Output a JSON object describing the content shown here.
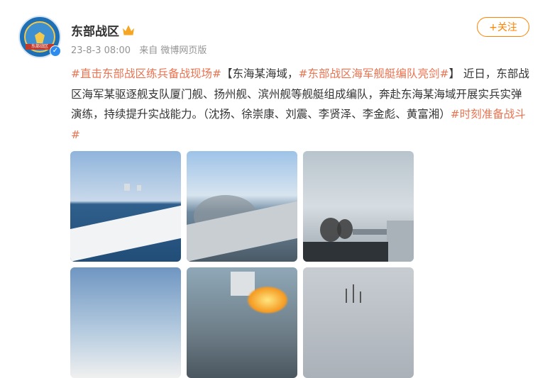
{
  "account": {
    "name": "东部战区",
    "avatar_banner": "东部战区",
    "verified_icon": "verified-badge-icon",
    "crown_icon": "crown-icon"
  },
  "post": {
    "date": "23-8-3 08:00",
    "source": "来自 微博网页版"
  },
  "follow_button": {
    "label": "+关注"
  },
  "content": {
    "tag1": "#直击东部战区练兵备战现场#",
    "part1": "【东海某海域，",
    "tag2": "#东部战区海军舰艇编队亮剑#",
    "part2": "】 近日，东部战区海军某驱逐舰支队厦门舰、扬州舰、滨州舰等舰艇组成编队，奔赴东海某海域开展实兵实弹演练，持续提升实战能力。（沈扬、徐崇康、刘震、李贤泽、李金彪、黄富湘）",
    "tag3": "#时刻准备战斗#"
  },
  "colors": {
    "tag": "#eb7350",
    "follow": "#ff8200",
    "meta": "#939393",
    "text": "#333333"
  },
  "images": [
    {
      "icon": "photo-ships-at-sea"
    },
    {
      "icon": "photo-deck-gun-firing"
    },
    {
      "icon": "photo-gun-smoke"
    },
    {
      "icon": "photo-sky-deck"
    },
    {
      "icon": "photo-missile-launch"
    },
    {
      "icon": "photo-grey-sky-ship"
    }
  ]
}
